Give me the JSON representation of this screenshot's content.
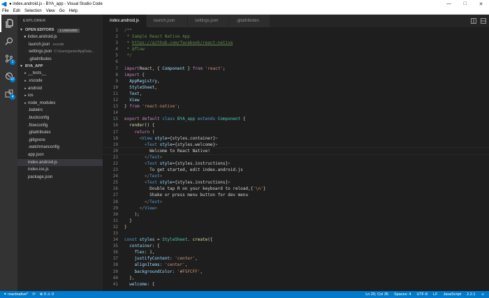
{
  "window": {
    "title": "● index.android.js - BYA_app - Visual Studio Code"
  },
  "menu": [
    "File",
    "Edit",
    "Selection",
    "View",
    "Go",
    "Help"
  ],
  "activity": {
    "git_badge": "1",
    "debug_badge": "47",
    "ext_badge": "4"
  },
  "sidebar": {
    "title": "EXPLORER",
    "open_editors": {
      "label": "OPEN EDITORS",
      "unsaved": "1 UNSAVED",
      "items": [
        {
          "name": "index.android.js",
          "desc": ""
        },
        {
          "name": "launch.json",
          "desc": ".vscode"
        },
        {
          "name": "settings.json",
          "desc": "C:\\Users\\jamie\\AppData..."
        },
        {
          "name": ".gitattributes",
          "desc": ""
        }
      ]
    },
    "project": {
      "label": "BYA_APP",
      "items": [
        {
          "name": "__tests__",
          "folder": true
        },
        {
          "name": ".vscode",
          "folder": true
        },
        {
          "name": "android",
          "folder": true
        },
        {
          "name": "ios",
          "folder": true
        },
        {
          "name": "node_modules",
          "folder": true
        },
        {
          "name": ".babelrc",
          "folder": false
        },
        {
          "name": ".buckconfig",
          "folder": false
        },
        {
          "name": ".flowconfig",
          "folder": false
        },
        {
          "name": ".gitattributes",
          "folder": false
        },
        {
          "name": ".gitignore",
          "folder": false
        },
        {
          "name": ".watchmanconfig",
          "folder": false
        },
        {
          "name": "app.json",
          "folder": false
        },
        {
          "name": "index.android.js",
          "folder": false
        },
        {
          "name": "index.ios.js",
          "folder": false
        },
        {
          "name": "package.json",
          "folder": false
        }
      ]
    }
  },
  "tabs": [
    {
      "label": "index.android.js"
    },
    {
      "label": "launch.json"
    },
    {
      "label": "settings.json"
    },
    {
      "label": ".gitattributes"
    }
  ],
  "code": [
    [
      [
        "c",
        "/**"
      ]
    ],
    [
      [
        "c",
        " * Sample React Native App"
      ]
    ],
    [
      [
        "c",
        " * "
      ],
      [
        "cu",
        "https://github.com/facebook/react-native"
      ]
    ],
    [
      [
        "c",
        " * @flow"
      ]
    ],
    [
      [
        "c",
        " */"
      ]
    ],
    [],
    [
      [
        "k",
        "import"
      ],
      [
        "",
        "React, { "
      ],
      [
        "v",
        "Component"
      ],
      [
        "",
        " } "
      ],
      [
        "k",
        "from"
      ],
      [
        "s",
        " 'react'"
      ],
      [
        "",
        ";"
      ]
    ],
    [
      [
        "k",
        "import"
      ],
      [
        "",
        " {"
      ]
    ],
    [
      [
        "v",
        "  AppRegistry"
      ],
      [
        "",
        ","
      ]
    ],
    [
      [
        "v",
        "  StyleSheet"
      ],
      [
        "",
        ","
      ]
    ],
    [
      [
        "v",
        "  Text"
      ],
      [
        "",
        ","
      ]
    ],
    [
      [
        "v",
        "  View"
      ]
    ],
    [
      [
        "",
        "} "
      ],
      [
        "k",
        "from"
      ],
      [
        "s",
        " 'react-native'"
      ],
      [
        "",
        ";"
      ]
    ],
    [],
    [
      [
        "k",
        "export default"
      ],
      [
        "b",
        " class"
      ],
      [
        "cl",
        " BYA_app"
      ],
      [
        "b",
        " extends"
      ],
      [
        "cl",
        " Component"
      ],
      [
        "",
        " {"
      ]
    ],
    [
      [
        "f",
        "  render"
      ],
      [
        "",
        "() {"
      ]
    ],
    [
      [
        "k",
        "    return"
      ],
      [
        "",
        " ("
      ]
    ],
    [
      [
        "tg",
        "      <"
      ],
      [
        "t",
        "View"
      ],
      [
        "v",
        " style"
      ],
      [
        "",
        "={styles.container}"
      ],
      [
        "tg",
        ">"
      ]
    ],
    [
      [
        "tg",
        "        <"
      ],
      [
        "t",
        "Text"
      ],
      [
        "v",
        " style"
      ],
      [
        "",
        "={styles.welcome}"
      ],
      [
        "tg",
        ">"
      ]
    ],
    [
      [
        "",
        "          Welcome to React Native!"
      ]
    ],
    [
      [
        "tg",
        "        </"
      ],
      [
        "t",
        "Text"
      ],
      [
        "tg",
        ">"
      ]
    ],
    [
      [
        "tg",
        "        <"
      ],
      [
        "t",
        "Text"
      ],
      [
        "v",
        " style"
      ],
      [
        "",
        "={styles.instructions}"
      ],
      [
        "tg",
        ">"
      ]
    ],
    [
      [
        "",
        "          To get started, edit index.android.js"
      ]
    ],
    [
      [
        "tg",
        "        </"
      ],
      [
        "t",
        "Text"
      ],
      [
        "tg",
        ">"
      ]
    ],
    [
      [
        "tg",
        "        <"
      ],
      [
        "t",
        "Text"
      ],
      [
        "v",
        " style"
      ],
      [
        "",
        "={styles.instructions}"
      ],
      [
        "tg",
        ">"
      ]
    ],
    [
      [
        "",
        "          Double tap R on your keyboard to reload,{"
      ],
      [
        "s",
        "'\\n'"
      ],
      [
        "",
        "}"
      ]
    ],
    [
      [
        "",
        "          Shake or press menu button for dev menu"
      ]
    ],
    [
      [
        "tg",
        "        </"
      ],
      [
        "t",
        "Text"
      ],
      [
        "tg",
        ">"
      ]
    ],
    [
      [
        "tg",
        "      </"
      ],
      [
        "t",
        "View"
      ],
      [
        "tg",
        ">"
      ]
    ],
    [
      [
        "",
        "    );"
      ]
    ],
    [
      [
        "",
        "  }"
      ]
    ],
    [
      [
        "",
        "}"
      ]
    ],
    [],
    [
      [
        "b",
        "const"
      ],
      [
        "v",
        " styles"
      ],
      [
        "",
        " = "
      ],
      [
        "cl",
        "StyleSheet"
      ],
      [
        "",
        ". "
      ],
      [
        "f",
        "create"
      ],
      [
        "",
        "({"
      ]
    ],
    [
      [
        "v",
        "  container"
      ],
      [
        "",
        ": {"
      ]
    ],
    [
      [
        "v",
        "    flex"
      ],
      [
        "",
        ": "
      ],
      [
        "n",
        "1"
      ],
      [
        "",
        ","
      ]
    ],
    [
      [
        "v",
        "    justifyContent"
      ],
      [
        "",
        ": "
      ],
      [
        "s",
        "'center'"
      ],
      [
        "",
        ","
      ]
    ],
    [
      [
        "v",
        "    alignItems"
      ],
      [
        "",
        ": "
      ],
      [
        "s",
        "'center'"
      ],
      [
        "",
        ","
      ]
    ],
    [
      [
        "v",
        "    backgroundColor"
      ],
      [
        "",
        ": "
      ],
      [
        "s",
        "'#F5FCFF'"
      ],
      [
        "",
        ","
      ]
    ],
    [
      [
        "",
        "  },"
      ]
    ],
    [
      [
        "v",
        "  welcome"
      ],
      [
        "",
        ": {"
      ]
    ]
  ],
  "status": {
    "branch": "reactnative*",
    "sync": "⟳",
    "errors": "0",
    "warnings": "0",
    "position": "Ln 20, Col 35",
    "spaces": "Spaces: 4",
    "encoding": "UTF-8",
    "eol": "LF",
    "language": "JavaScript",
    "version": "2.2.1"
  }
}
